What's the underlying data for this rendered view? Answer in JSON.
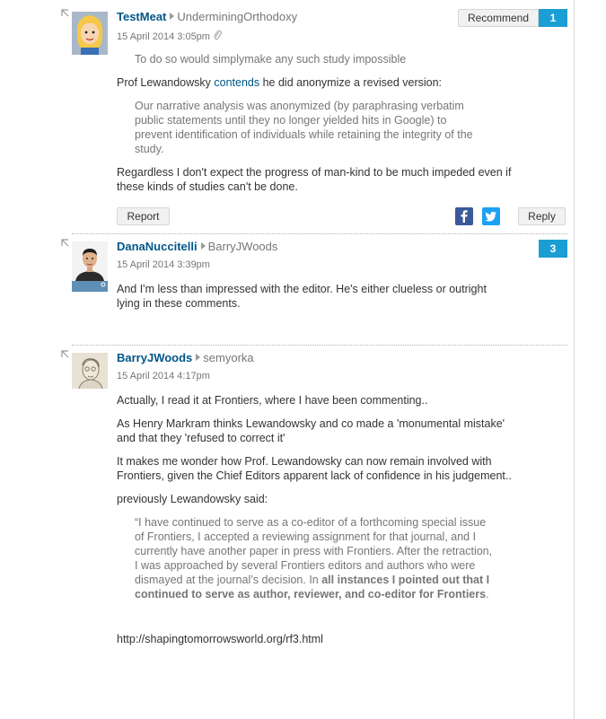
{
  "comments": [
    {
      "author": "TestMeat",
      "reply_to": "UnderminingOrthodoxy",
      "date": "15 April 2014 3:05pm",
      "recommend_label": "Recommend",
      "recommend_count": "1",
      "quote1": "To do so would simplymake any such study impossible",
      "p1_before": "Prof Lewandowsky ",
      "p1_link": "contends",
      "p1_after": " he did anonymize a revised version:",
      "quote2": "Our narrative analysis was anonymized (by paraphrasing verbatim public statements until they no longer yielded hits in Google) to prevent identification of individuals while retaining the integrity of the study.",
      "p2": "Regardless I don't expect the progress of man-kind to be much impeded even if these kinds of studies can't be done.",
      "report_label": "Report",
      "reply_label": "Reply",
      "avatar_icon": "cartoon-blonde-avatar"
    },
    {
      "author": "DanaNuccitelli",
      "reply_to": "BarryJWoods",
      "date": "15 April 2014 3:39pm",
      "recommend_count": "3",
      "p1": "And I'm less than impressed with the editor. He's either clueless or outright lying in these comments.",
      "avatar_icon": "photo-man-avatar"
    },
    {
      "author": "BarryJWoods",
      "reply_to": "semyorka",
      "date": "15 April 2014 4:17pm",
      "p1": "Actually, I read it at Frontiers, where I have been commenting..",
      "p2": "As Henry Markram thinks Lewandowsky and co made a 'monumental mistake' and that they 'refused to correct it'",
      "p3": "It makes me wonder how Prof. Lewandowsky can now remain involved with Frontiers, given the Chief Editors apparent lack of confidence in his judgement..",
      "p4": "previously Lewandowsky said:",
      "quote_plain": "“I have continued to serve as a co-editor of a forthcoming special issue of Frontiers, I accepted a reviewing assignment for that journal, and I currently have another paper in press with Frontiers. After the retraction, I was approached by several Frontiers editors and authors who were dismayed at the journal’s decision. In ",
      "quote_bold": "all instances I pointed out that I continued to serve as author, reviewer, and co-editor for Frontiers",
      "quote_end": ".",
      "url": "http://shapingtomorrowsworld.org/rf3.html",
      "avatar_icon": "sketch-portrait-avatar"
    }
  ],
  "colors": {
    "accent": "#1b9ed4",
    "author": "#005689",
    "facebook": "#3b5998",
    "twitter": "#1da1f2"
  }
}
